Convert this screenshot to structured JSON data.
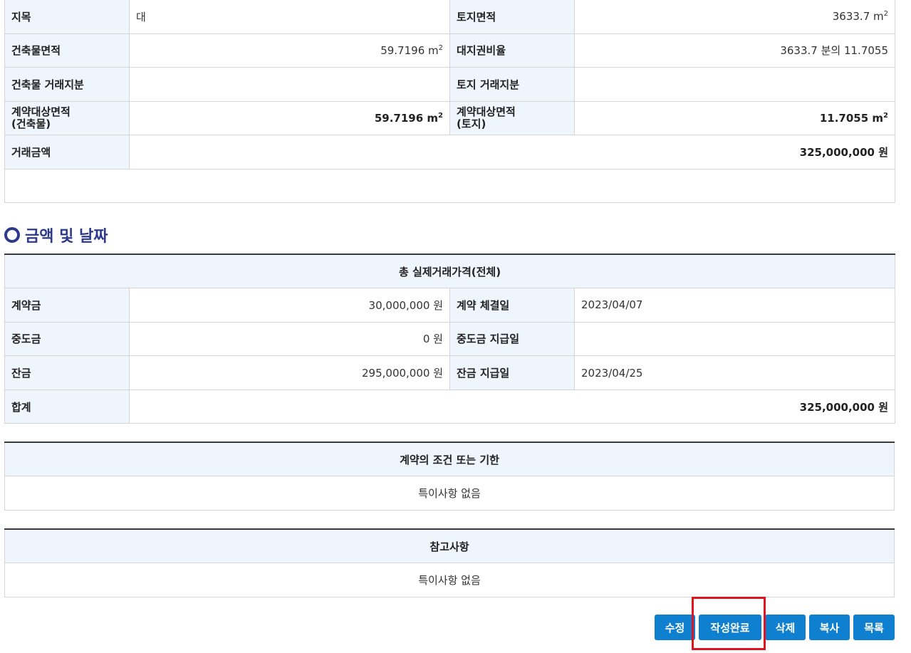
{
  "land_info": {
    "rows": [
      {
        "label1": "지목",
        "value1": "대",
        "label2": "토지면적",
        "value2": "3633.7 m",
        "value2_sup": "2"
      },
      {
        "label1": "건축물면적",
        "value1": "59.7196 m",
        "value1_sup": "2",
        "label2": "대지권비율",
        "value2": "3633.7 분의 11.7055"
      },
      {
        "label1": "건축물 거래지분",
        "value1": "",
        "label2": "토지 거래지분",
        "value2": ""
      },
      {
        "label1a": "계약대상면적",
        "label1b": "(건축물)",
        "value1": "59.7196 m",
        "value1_sup": "2",
        "label2a": "계약대상면적",
        "label2b": "(토지)",
        "value2": "11.7055 m",
        "value2_sup": "2"
      },
      {
        "label1": "거래금액",
        "value1": "325,000,000 원"
      }
    ]
  },
  "money_section": {
    "title": "금액 및 날짜",
    "header": "총 실제거래가격(전체)",
    "rows": [
      {
        "label1": "계약금",
        "value1": "30,000,000 원",
        "label2": "계약 체결일",
        "value2": "2023/04/07"
      },
      {
        "label1": "중도금",
        "value1": "0 원",
        "label2": "중도금 지급일",
        "value2": ""
      },
      {
        "label1": "잔금",
        "value1": "295,000,000 원",
        "label2": "잔금 지급일",
        "value2": "2023/04/25"
      },
      {
        "label1": "합계",
        "value1": "325,000,000 원"
      }
    ]
  },
  "conditions": {
    "header": "계약의 조건 또는 기한",
    "value": "특이사항 없음"
  },
  "reference": {
    "header": "참고사항",
    "value": "특이사항 없음"
  },
  "buttons": {
    "edit": "수정",
    "complete": "작성완료",
    "delete": "삭제",
    "copy": "복사",
    "list": "목록"
  },
  "colors": {
    "header_bg": "#eef5fc",
    "button_blue": "#0f7fcf",
    "title_navy": "#2d3a8c",
    "highlight_red": "#e0141f"
  }
}
